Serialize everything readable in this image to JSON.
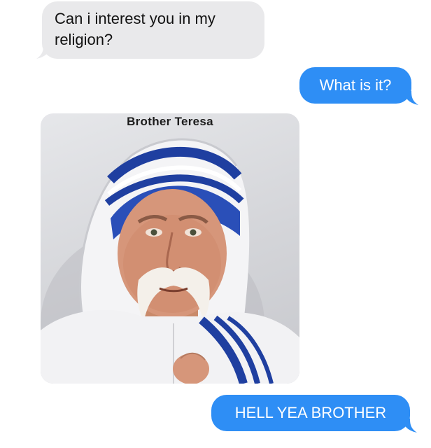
{
  "messages": [
    {
      "sender": "other",
      "text": "Can i interest you in my religion?"
    },
    {
      "sender": "me",
      "text": "What is it?"
    },
    {
      "sender": "other",
      "type": "image",
      "caption": "Brother Teresa",
      "image_icon": "meme-portrait-image"
    },
    {
      "sender": "me",
      "text": "HELL YEA BROTHER"
    }
  ],
  "colors": {
    "incoming_bubble": "#e9e9eb",
    "outgoing_bubble": "#2e8ef5",
    "outgoing_text": "#ffffff",
    "incoming_text": "#111111"
  }
}
